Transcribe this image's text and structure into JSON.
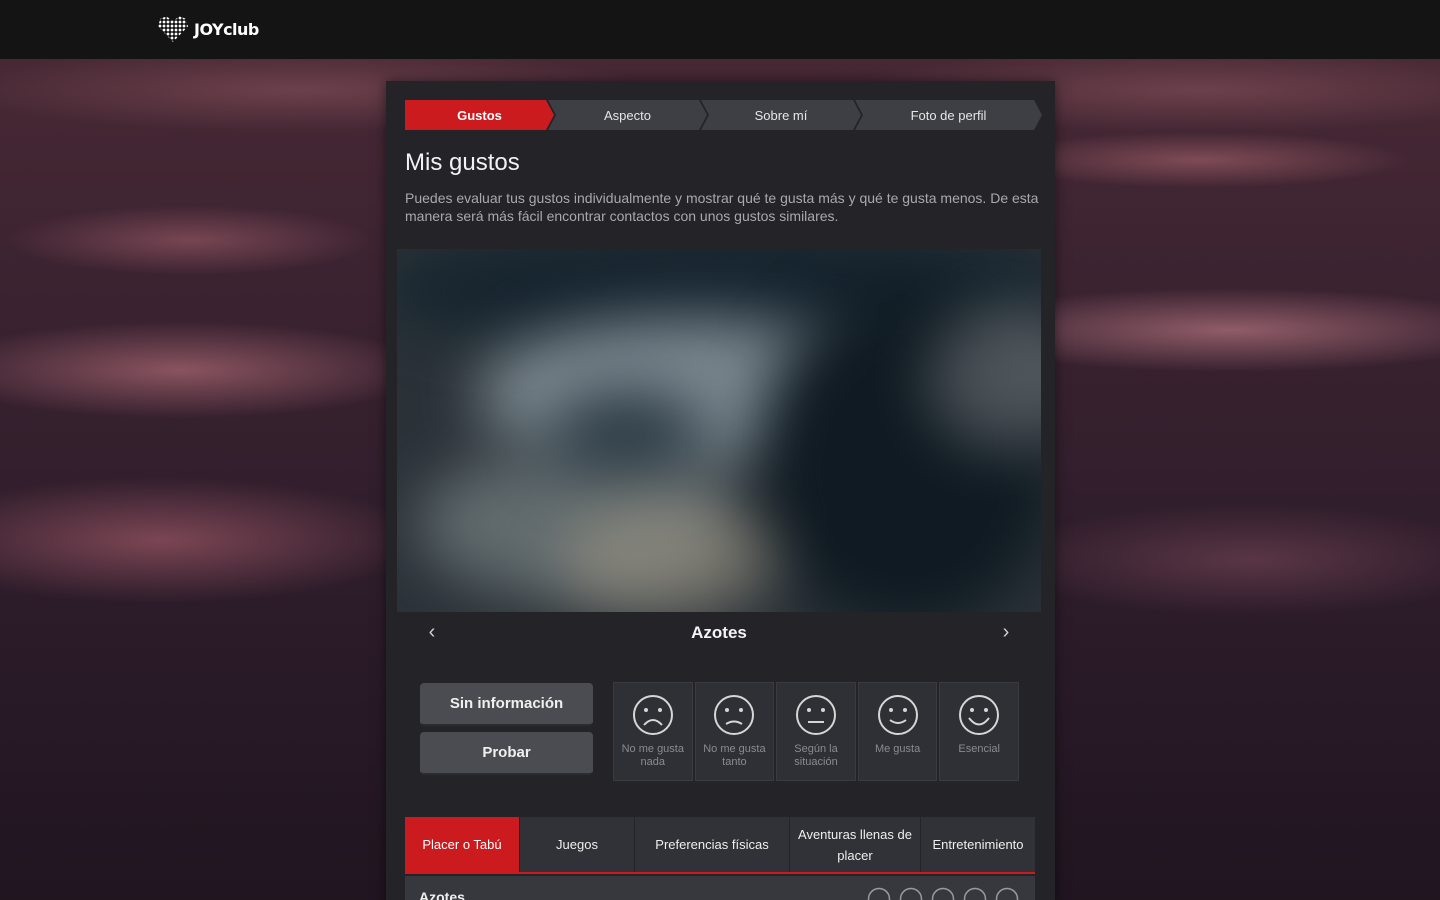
{
  "brand": {
    "name": "JOYclub"
  },
  "steps": [
    {
      "label": "Gustos",
      "active": true
    },
    {
      "label": "Aspecto",
      "active": false
    },
    {
      "label": "Sobre mí",
      "active": false
    },
    {
      "label": "Foto de perfil",
      "active": false
    }
  ],
  "page": {
    "title": "Mis gustos",
    "intro": "Puedes evaluar tus gustos individualmente y mostrar qué te gusta más y qué te gusta menos. De esta manera será más fácil encontrar contactos con unos gustos similares."
  },
  "carousel": {
    "caption": "Azotes",
    "prev_icon": "chevron-left-icon",
    "next_icon": "chevron-right-icon"
  },
  "actions": {
    "no_info": "Sin información",
    "try": "Probar"
  },
  "ratings": [
    {
      "label": "No me gusta nada",
      "icon": "very-sad-face-icon"
    },
    {
      "label": "No me gusta tanto",
      "icon": "sad-face-icon"
    },
    {
      "label": "Según la situación",
      "icon": "neutral-face-icon"
    },
    {
      "label": "Me gusta",
      "icon": "smile-face-icon"
    },
    {
      "label": "Esencial",
      "icon": "big-smile-face-icon"
    }
  ],
  "categories": [
    {
      "label": "Placer o Tabú",
      "active": true
    },
    {
      "label": "Juegos",
      "active": false
    },
    {
      "label": "Preferencias físicas",
      "active": false
    },
    {
      "label": "Aventuras llenas de placer",
      "active": false
    },
    {
      "label": "Entretenimiento",
      "active": false
    }
  ],
  "list": [
    {
      "label": "Azotes"
    }
  ],
  "colors": {
    "accent": "#cc1b1e",
    "panel": "#242428",
    "topbar": "#141414"
  }
}
